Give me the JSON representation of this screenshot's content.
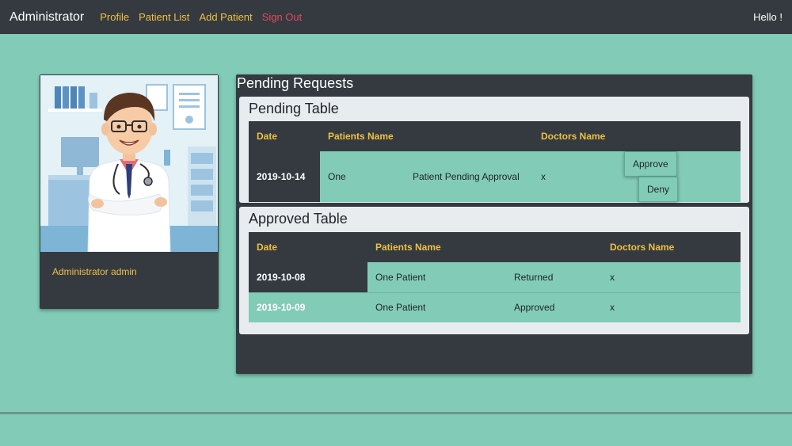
{
  "navbar": {
    "brand": "Administrator",
    "links": [
      "Profile",
      "Patient List",
      "Add Patient"
    ],
    "signout": "Sign Out",
    "greeting": "Hello !"
  },
  "profile": {
    "name": "Administrator admin"
  },
  "main": {
    "title": "Pending Requests",
    "pending": {
      "title": "Pending Table",
      "headers": [
        "Date",
        "Patients Name",
        "",
        "Doctors Name",
        ""
      ],
      "rows": [
        {
          "date": "2019-10-14",
          "patient": "One",
          "status": "Patient Pending Approval",
          "doctor": "x",
          "approve": "Approve",
          "deny": "Deny"
        }
      ]
    },
    "approved": {
      "title": "Approved Table",
      "headers": [
        "Date",
        "Patients Name",
        "",
        "Doctors Name"
      ],
      "rows": [
        {
          "date": "2019-10-08",
          "patient": "One Patient",
          "status": "Returned",
          "doctor": "x"
        },
        {
          "date": "2019-10-09",
          "patient": "One Patient",
          "status": "Approved",
          "doctor": "x"
        }
      ]
    }
  },
  "colors": {
    "background": "#82ccb7",
    "dark": "#343a40",
    "accent": "#f0c040",
    "danger": "#e4495a",
    "card": "#e9ecef"
  }
}
